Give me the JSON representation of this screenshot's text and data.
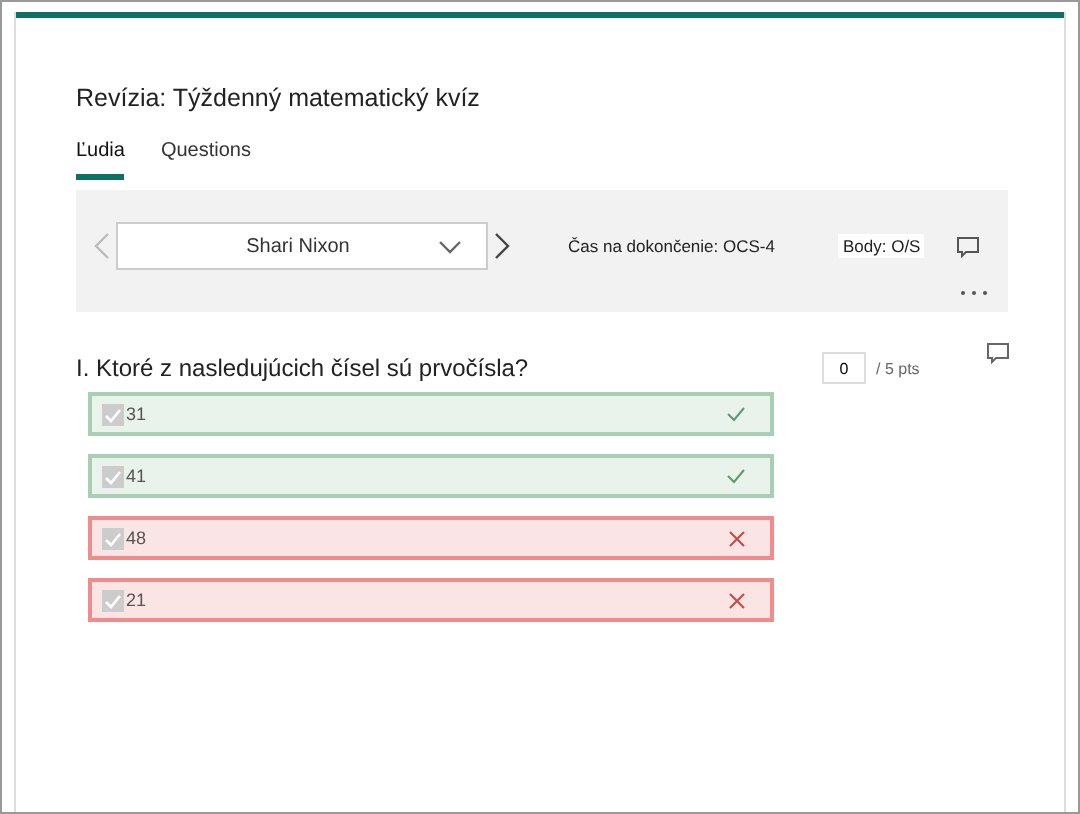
{
  "title": "Revízia: Týždenný matematický kvíz",
  "tabs": [
    {
      "label": "Ľudia",
      "selected": true
    },
    {
      "label": "Questions",
      "selected": false
    }
  ],
  "respondent": {
    "name": "Shari Nixon",
    "time": "Čas na dokončenie: OCS-4",
    "points": "Body: O/S"
  },
  "question": {
    "text": "I. Ktoré z nasledujúcich čísel sú prvočísla?",
    "score": "0",
    "max": "/ 5 pts",
    "options": [
      {
        "label": "31",
        "checked": true,
        "kind": "correct"
      },
      {
        "label": "41",
        "checked": true,
        "kind": "correct"
      },
      {
        "label": "48",
        "checked": true,
        "kind": "incorrect"
      },
      {
        "label": "21",
        "checked": true,
        "kind": "incorrect"
      }
    ]
  }
}
